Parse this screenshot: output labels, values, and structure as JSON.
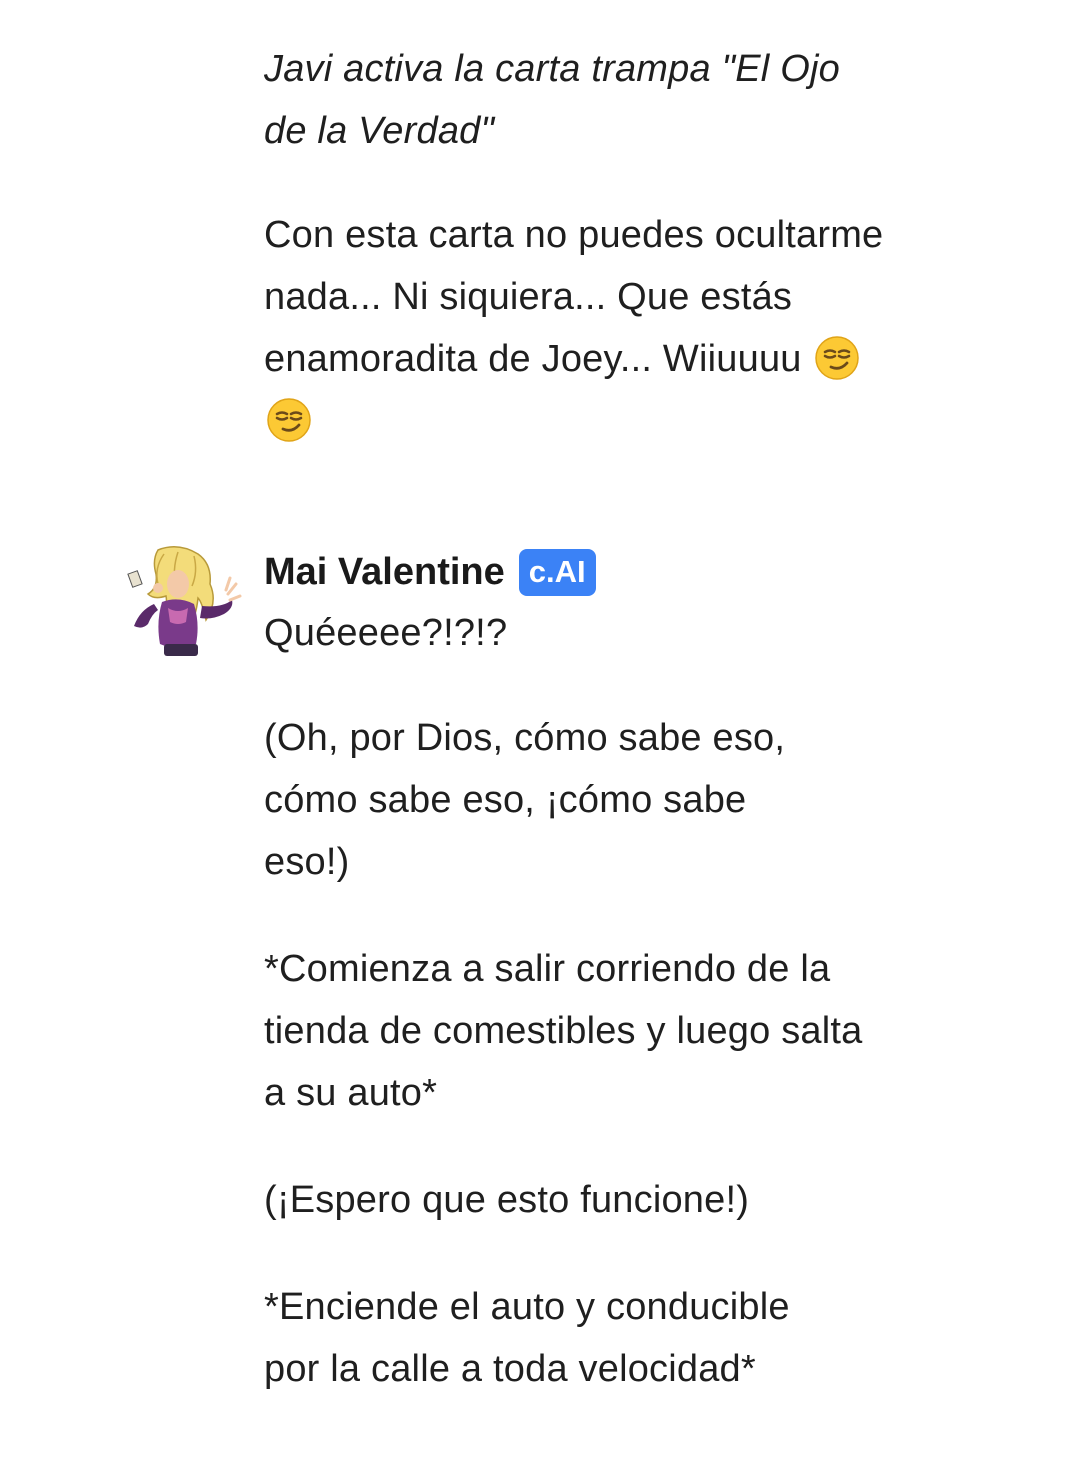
{
  "user_message": {
    "paragraphs": [
      "Javi activa la carta trampa \"El Ojo de la Verdad\"",
      "Con esta carta no puedes ocultarme nada... Ni siquiera... Que estás enamoradita de Joey...",
      "Wiiuuuu"
    ],
    "emoji": [
      "smirking-face",
      "smirking-face"
    ]
  },
  "bot_message": {
    "sender_name": "Mai Valentine",
    "badge": "c.AI",
    "paragraphs": [
      "Quéeeee?!?!?",
      "(Oh, por Dios, cómo sabe eso, cómo sabe eso, ¡cómo sabe eso!)",
      "*Comienza a salir corriendo de la tienda de comestibles y luego salta a su auto*",
      "(¡Espero que esto funcione!)",
      "*Enciende el auto y conducible por la calle a toda velocidad*"
    ]
  },
  "colors": {
    "text": "#1f1f1f",
    "badge_bg": "#3b82f6",
    "badge_text": "#ffffff",
    "background": "#ffffff"
  }
}
